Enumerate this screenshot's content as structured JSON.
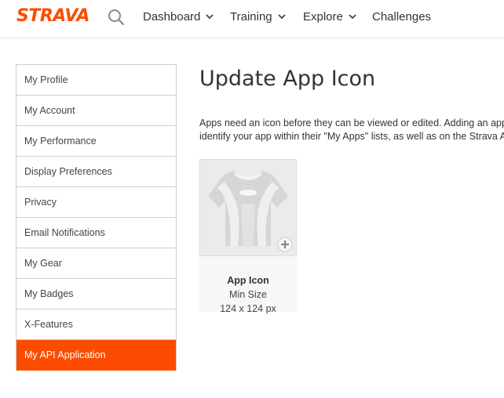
{
  "nav": {
    "logo": "STRAVA",
    "items": [
      {
        "label": "Dashboard",
        "has_menu": true
      },
      {
        "label": "Training",
        "has_menu": true
      },
      {
        "label": "Explore",
        "has_menu": true
      },
      {
        "label": "Challenges",
        "has_menu": false
      }
    ]
  },
  "sidebar": {
    "items": [
      {
        "label": "My Profile"
      },
      {
        "label": "My Account"
      },
      {
        "label": "My Performance"
      },
      {
        "label": "Display Preferences"
      },
      {
        "label": "Privacy"
      },
      {
        "label": "Email Notifications"
      },
      {
        "label": "My Gear"
      },
      {
        "label": "My Badges"
      },
      {
        "label": "X-Features"
      },
      {
        "label": "My API Application",
        "active": true
      }
    ]
  },
  "main": {
    "title": "Update App Icon",
    "description_line1": "Apps need an icon before they can be viewed or edited. Adding an app icon will help you",
    "description_line2": "identify your app within their \"My Apps\" lists, as well as on the Strava API",
    "icon_card": {
      "title": "App Icon",
      "subtitle": "Min Size",
      "size": "124 x 124 px"
    }
  },
  "colors": {
    "brand": "#fc4c02",
    "active_text": "#ffffff"
  }
}
